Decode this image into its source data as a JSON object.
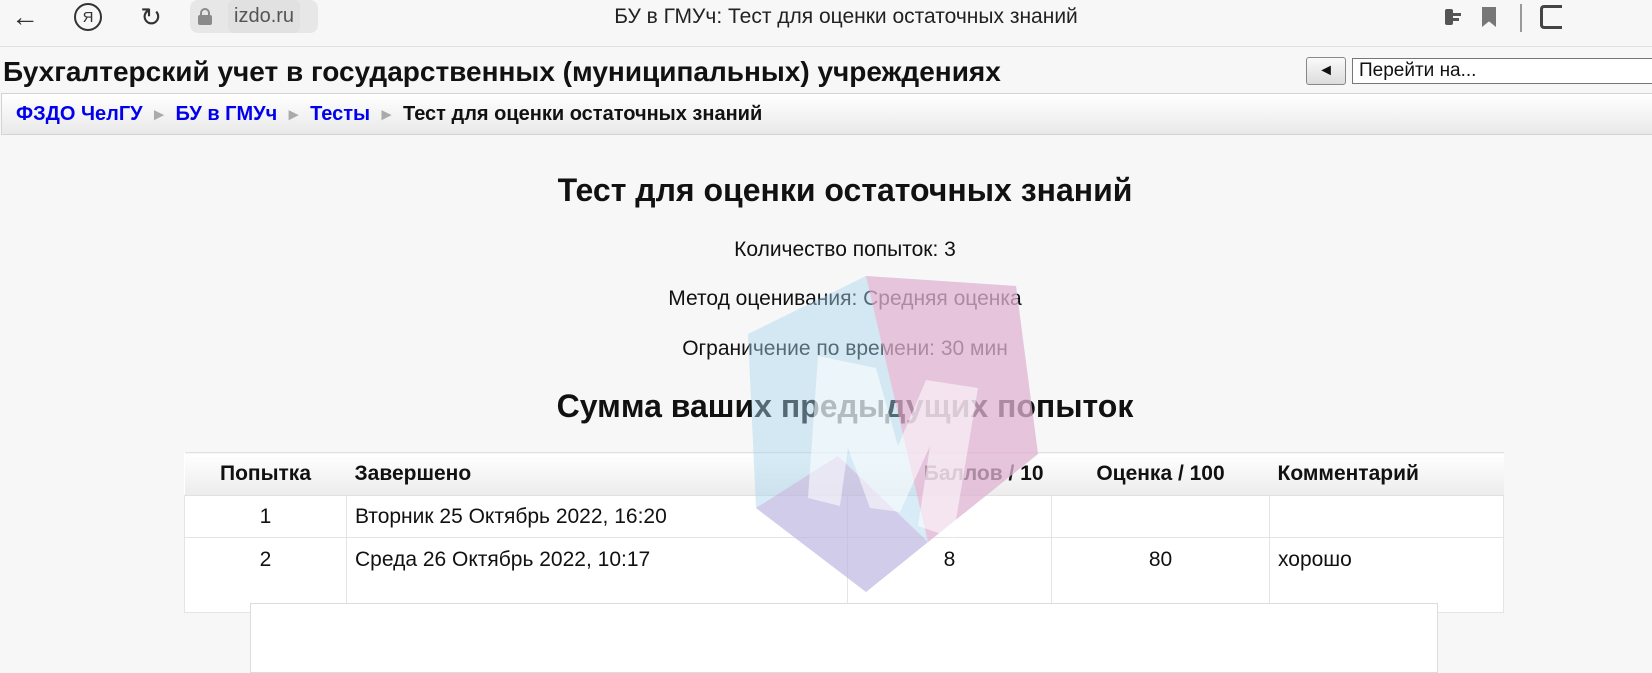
{
  "browser": {
    "host": "izdo.ru",
    "tab_title": "БУ в ГМУч: Тест для оценки остаточных знаний",
    "yandex_letter": "Я"
  },
  "header": {
    "course_title": "Бухгалтерский учет в государственных (муниципальных) учреждениях",
    "nav_prev_label": "◄",
    "jump_placeholder": "Перейти на..."
  },
  "breadcrumb": {
    "items": [
      "ФЗДО ЧелГУ",
      "БУ в ГМУч",
      "Тесты"
    ],
    "current": "Тест для оценки остаточных знаний",
    "separator": "►"
  },
  "quiz": {
    "title": "Тест для оценки остаточных знаний",
    "attempts_info": "Количество попыток: 3",
    "grading_method": "Метод оценивания: Средняя оценка",
    "time_limit": "Ограничение по времени: 30 мин",
    "summary_title": "Сумма ваших предыдущих попыток"
  },
  "table": {
    "headers": [
      "Попытка",
      "Завершено",
      "Баллов / 10",
      "Оценка / 100",
      "Комментарий"
    ],
    "rows": [
      [
        "1",
        "Вторник 25 Октябрь 2022, 16:20",
        "",
        "",
        ""
      ],
      [
        "2",
        "Среда 26 Октябрь 2022, 10:17",
        "8",
        "80",
        "хорошо"
      ]
    ]
  },
  "colors": {
    "link": "#0000ee",
    "watermark_blue": "#a9d4ee",
    "watermark_pink": "#f2a6c8"
  }
}
